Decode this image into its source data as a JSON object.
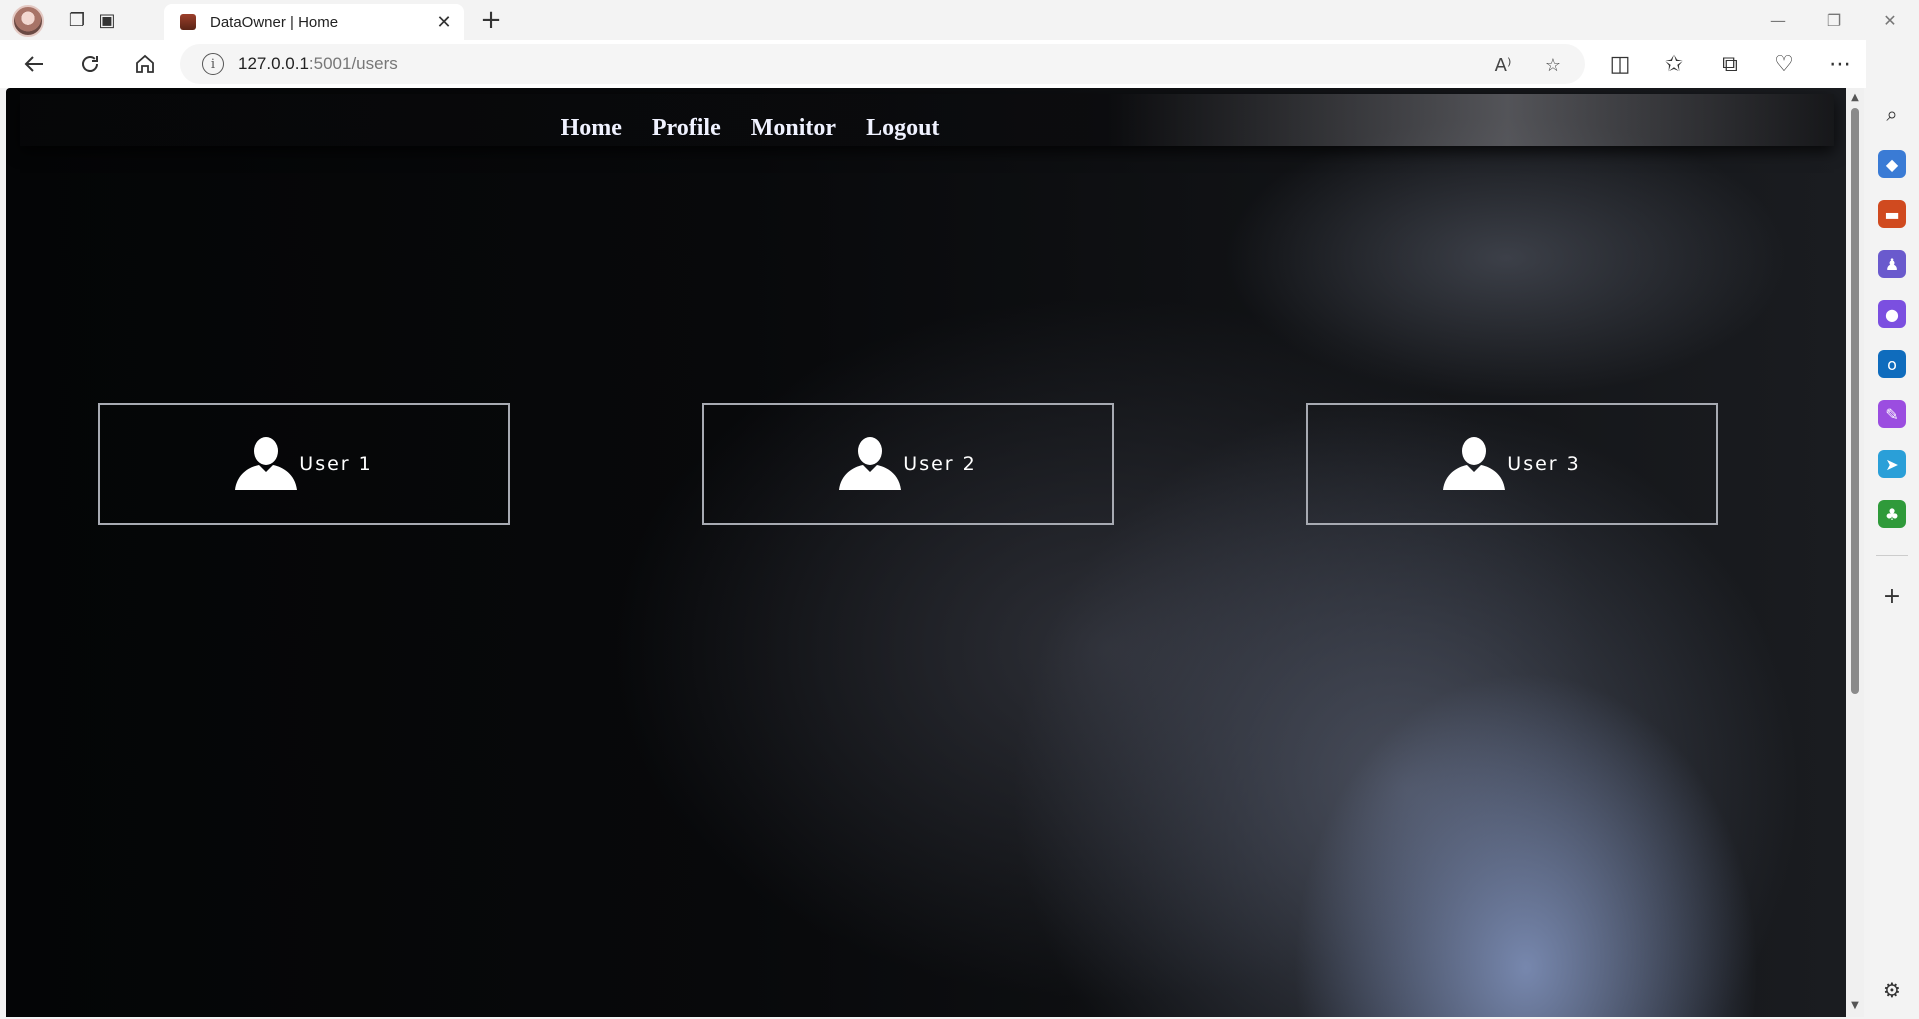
{
  "browser": {
    "tab_title": "DataOwner | Home",
    "url_host": "127.0.0.1",
    "url_rest": ":5001/users",
    "new_tab_symbol": "+",
    "tab_close_symbol": "✕"
  },
  "site": {
    "nav": [
      {
        "label": "Home"
      },
      {
        "label": "Profile"
      },
      {
        "label": "Monitor"
      },
      {
        "label": "Logout"
      }
    ],
    "users": [
      {
        "label": "User 1"
      },
      {
        "label": "User 2"
      },
      {
        "label": "User 3"
      }
    ]
  },
  "icons": {
    "back": "back-arrow-icon",
    "refresh": "refresh-icon",
    "home": "home-icon",
    "info": "info-icon",
    "read_aloud": "read-aloud-icon",
    "favorite": "star-icon",
    "split": "split-screen-icon",
    "favorites": "favorites-icon",
    "collections": "collections-icon",
    "health": "browser-essentials-icon",
    "more": "more-icon",
    "copilot": "copilot-icon",
    "user": "user-silhouette-icon"
  },
  "colors": {
    "nav_text": "#f0f2ff",
    "card_border": "#a7aab2",
    "card_text": "#ffffff"
  }
}
